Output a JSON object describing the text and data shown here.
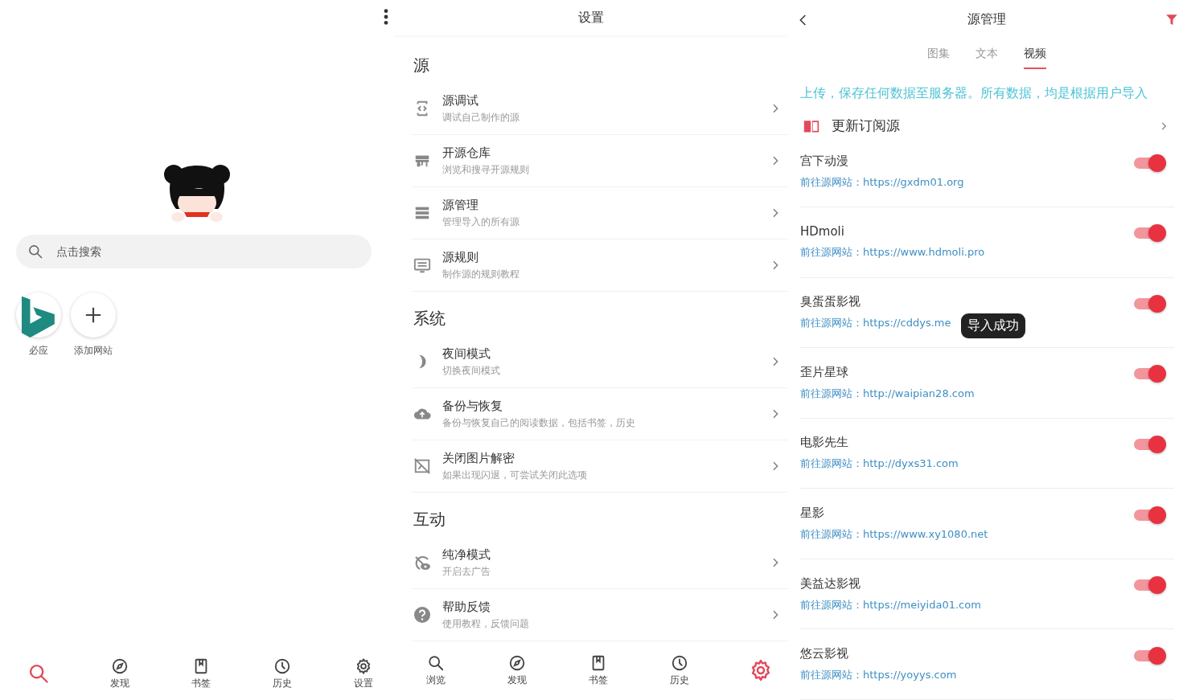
{
  "home": {
    "search": {
      "placeholder": "点击搜索"
    },
    "shortcuts": [
      {
        "kind": "logo",
        "label": "必应"
      },
      {
        "kind": "add",
        "label": "添加网站"
      }
    ],
    "nav": [
      {
        "selected": true
      },
      {
        "label": "发现",
        "selected": false
      },
      {
        "label": "书签",
        "selected": false
      },
      {
        "label": "历史",
        "selected": false
      },
      {
        "label": "设置",
        "selected": false
      }
    ]
  },
  "settings": {
    "title": "设置",
    "sections": [
      {
        "title": "源",
        "items": [
          {
            "title": "源调试",
            "subtitle": "调试自己制作的源"
          },
          {
            "title": "开源仓库",
            "subtitle": "浏览和搜寻开源规则"
          },
          {
            "title": "源管理",
            "subtitle": "管理导入的所有源"
          },
          {
            "title": "源规则",
            "subtitle": "制作源的规则教程"
          }
        ]
      },
      {
        "title": "系统",
        "items": [
          {
            "title": "夜间模式",
            "subtitle": "切换夜间模式"
          },
          {
            "title": "备份与恢复",
            "subtitle": "备份与恢复自己的阅读数据，包括书签，历史"
          },
          {
            "title": "关闭图片解密",
            "subtitle": "如果出现闪退，可尝试关闭此选项"
          }
        ]
      },
      {
        "title": "互动",
        "items": [
          {
            "title": "纯净模式",
            "subtitle": "开启去广告"
          },
          {
            "title": "帮助反馈",
            "subtitle": "使用教程，反馈问题"
          }
        ]
      }
    ],
    "nav": [
      {
        "label": "浏览",
        "selected": false
      },
      {
        "label": "发现",
        "selected": false
      },
      {
        "label": "书签",
        "selected": false
      },
      {
        "label": "历史",
        "selected": false
      },
      {
        "selected": true
      }
    ]
  },
  "sources": {
    "title": "源管理",
    "tabs": [
      {
        "label": "图集",
        "selected": false
      },
      {
        "label": "文本",
        "selected": false
      },
      {
        "label": "视频",
        "selected": true
      }
    ],
    "notice": "上传，保存任何数据至服务器。所有数据，均是根据用户导入",
    "subscribe": "更新订阅源",
    "items": [
      {
        "name": "宫下动漫",
        "link": "前往源网站：https://gxdm01.org",
        "on": true
      },
      {
        "name": "HDmoli",
        "link": "前往源网站：https://www.hdmoli.pro",
        "on": true
      },
      {
        "name": "臭蛋蛋影视",
        "link": "前往源网站：https://cddys.me",
        "on": true
      },
      {
        "name": "歪片星球",
        "link": "前往源网站：http://waipian28.com",
        "on": true
      },
      {
        "name": "电影先生",
        "link": "前往源网站：http://dyxs31.com",
        "on": true
      },
      {
        "name": "星影",
        "link": "前往源网站：https://www.xy1080.net",
        "on": true
      },
      {
        "name": "美益达影视",
        "link": "前往源网站：https://meiyida01.com",
        "on": true
      },
      {
        "name": "悠云影视",
        "link": "前往源网站：https://yoyys.com",
        "on": true
      }
    ],
    "toast": "导入成功"
  }
}
